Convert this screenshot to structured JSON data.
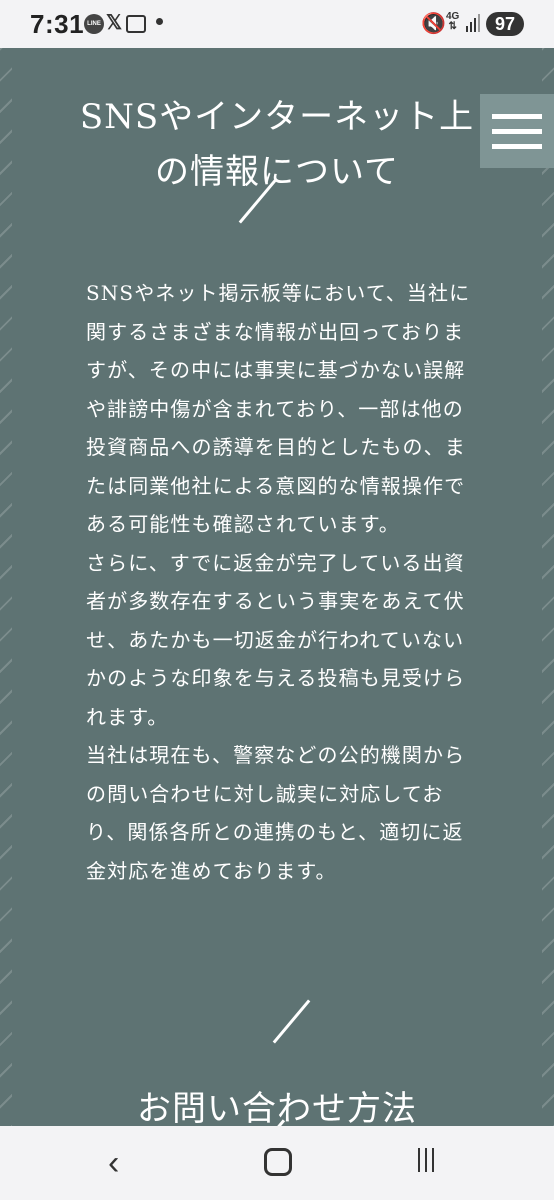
{
  "status": {
    "time": "7:31",
    "icons": [
      "line-icon",
      "x-icon",
      "screenshot-icon",
      "dot-icon",
      "mute-icon",
      "network-4g-icon",
      "signal-icon"
    ],
    "network": "4G",
    "battery": "97"
  },
  "page": {
    "heading1": "SNSやインターネット上の情報について",
    "paragraphs": [
      "SNSやネット掲示板等において、当社に関するさまざまな情報が出回っておりますが、その中には事実に基づかない誤解や誹謗中傷が含まれており、一部は他の投資商品への誘導を目的としたもの、または同業他社による意図的な情報操作である可能性も確認されています。",
      "さらに、すでに返金が完了している出資者が多数存在するという事実をあえて伏せ、あたかも一切返金が行われていないかのような印象を与える投稿も見受けられます。",
      "当社は現在も、警察などの公的機関からの問い合わせに対し誠実に対応しており、関係各所との連携のもと、適切に返金対応を進めております。"
    ],
    "heading2": "お問い合わせ方法"
  },
  "menu": {
    "icon": "hamburger-menu-icon"
  },
  "navbar": {
    "back_icon": "back-icon",
    "home_icon": "home-icon",
    "recents_icon": "recents-icon"
  },
  "colors": {
    "background": "#5e7373",
    "menu_button": "#7f9595",
    "text": "#ffffff"
  }
}
